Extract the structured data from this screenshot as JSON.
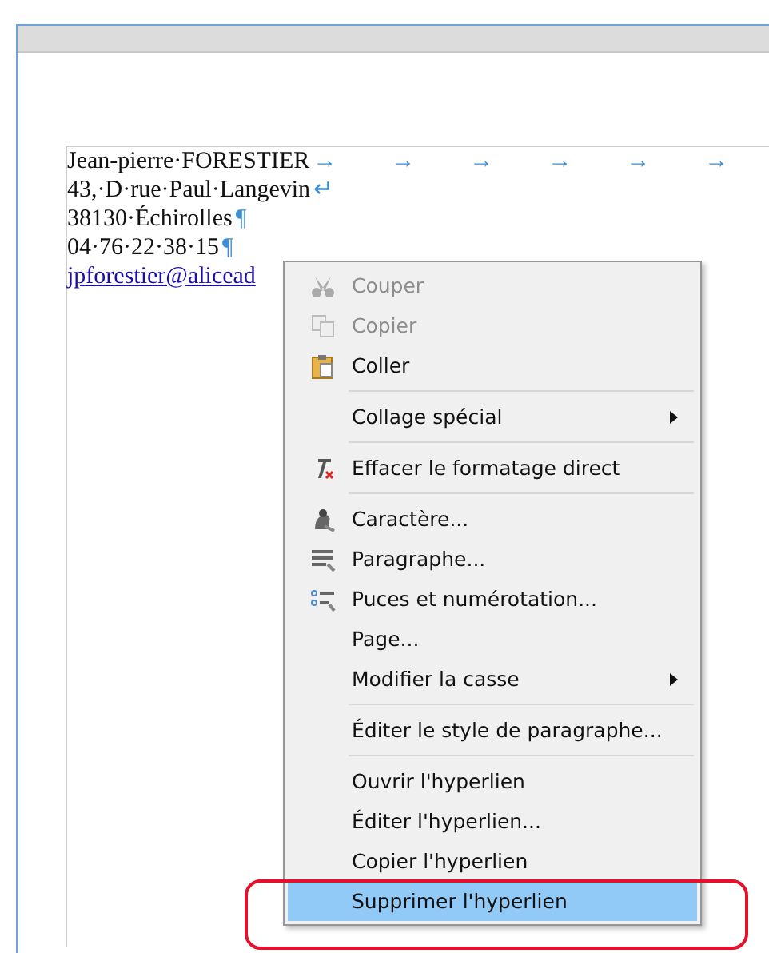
{
  "document": {
    "lines": [
      {
        "kind": "text",
        "text": "Jean-pierre·FORESTIER",
        "marks": [
          "→",
          "→",
          "→",
          "→",
          "→",
          "→"
        ]
      },
      {
        "kind": "text",
        "text": "43,·D·rue·Paul·Langevin",
        "marks": [
          "↵"
        ]
      },
      {
        "kind": "text",
        "text": "38130·Échirolles",
        "marks": [
          "¶"
        ]
      },
      {
        "kind": "text",
        "text": "04·76·22·38·15",
        "marks": [
          "¶"
        ]
      },
      {
        "kind": "link",
        "text": "jpforestier@alicead"
      }
    ]
  },
  "context_menu": {
    "items": [
      {
        "label": "Couper",
        "disabled": true,
        "submenu": false,
        "selected": false,
        "separator_after": false
      },
      {
        "label": "Copier",
        "disabled": true,
        "submenu": false,
        "selected": false,
        "separator_after": false
      },
      {
        "label": "Coller",
        "disabled": false,
        "submenu": false,
        "selected": false,
        "separator_after": true
      },
      {
        "label": "Collage spécial",
        "disabled": false,
        "submenu": true,
        "selected": false,
        "separator_after": true
      },
      {
        "label": "Effacer le formatage direct",
        "disabled": false,
        "submenu": false,
        "selected": false,
        "separator_after": true
      },
      {
        "label": "Caractère...",
        "disabled": false,
        "submenu": false,
        "selected": false,
        "separator_after": false
      },
      {
        "label": "Paragraphe...",
        "disabled": false,
        "submenu": false,
        "selected": false,
        "separator_after": false
      },
      {
        "label": "Puces et numérotation...",
        "disabled": false,
        "submenu": false,
        "selected": false,
        "separator_after": false
      },
      {
        "label": "Page...",
        "disabled": false,
        "submenu": false,
        "selected": false,
        "separator_after": false
      },
      {
        "label": "Modifier la casse",
        "disabled": false,
        "submenu": true,
        "selected": false,
        "separator_after": true
      },
      {
        "label": "Éditer le style de paragraphe...",
        "disabled": false,
        "submenu": false,
        "selected": false,
        "separator_after": true
      },
      {
        "label": "Ouvrir l'hyperlien",
        "disabled": false,
        "submenu": false,
        "selected": false,
        "separator_after": false
      },
      {
        "label": "Éditer l'hyperlien...",
        "disabled": false,
        "submenu": false,
        "selected": false,
        "separator_after": false
      },
      {
        "label": "Copier l'hyperlien",
        "disabled": false,
        "submenu": false,
        "selected": false,
        "separator_after": false
      },
      {
        "label": "Supprimer l'hyperlien",
        "disabled": false,
        "submenu": false,
        "selected": true,
        "separator_after": false
      }
    ]
  }
}
